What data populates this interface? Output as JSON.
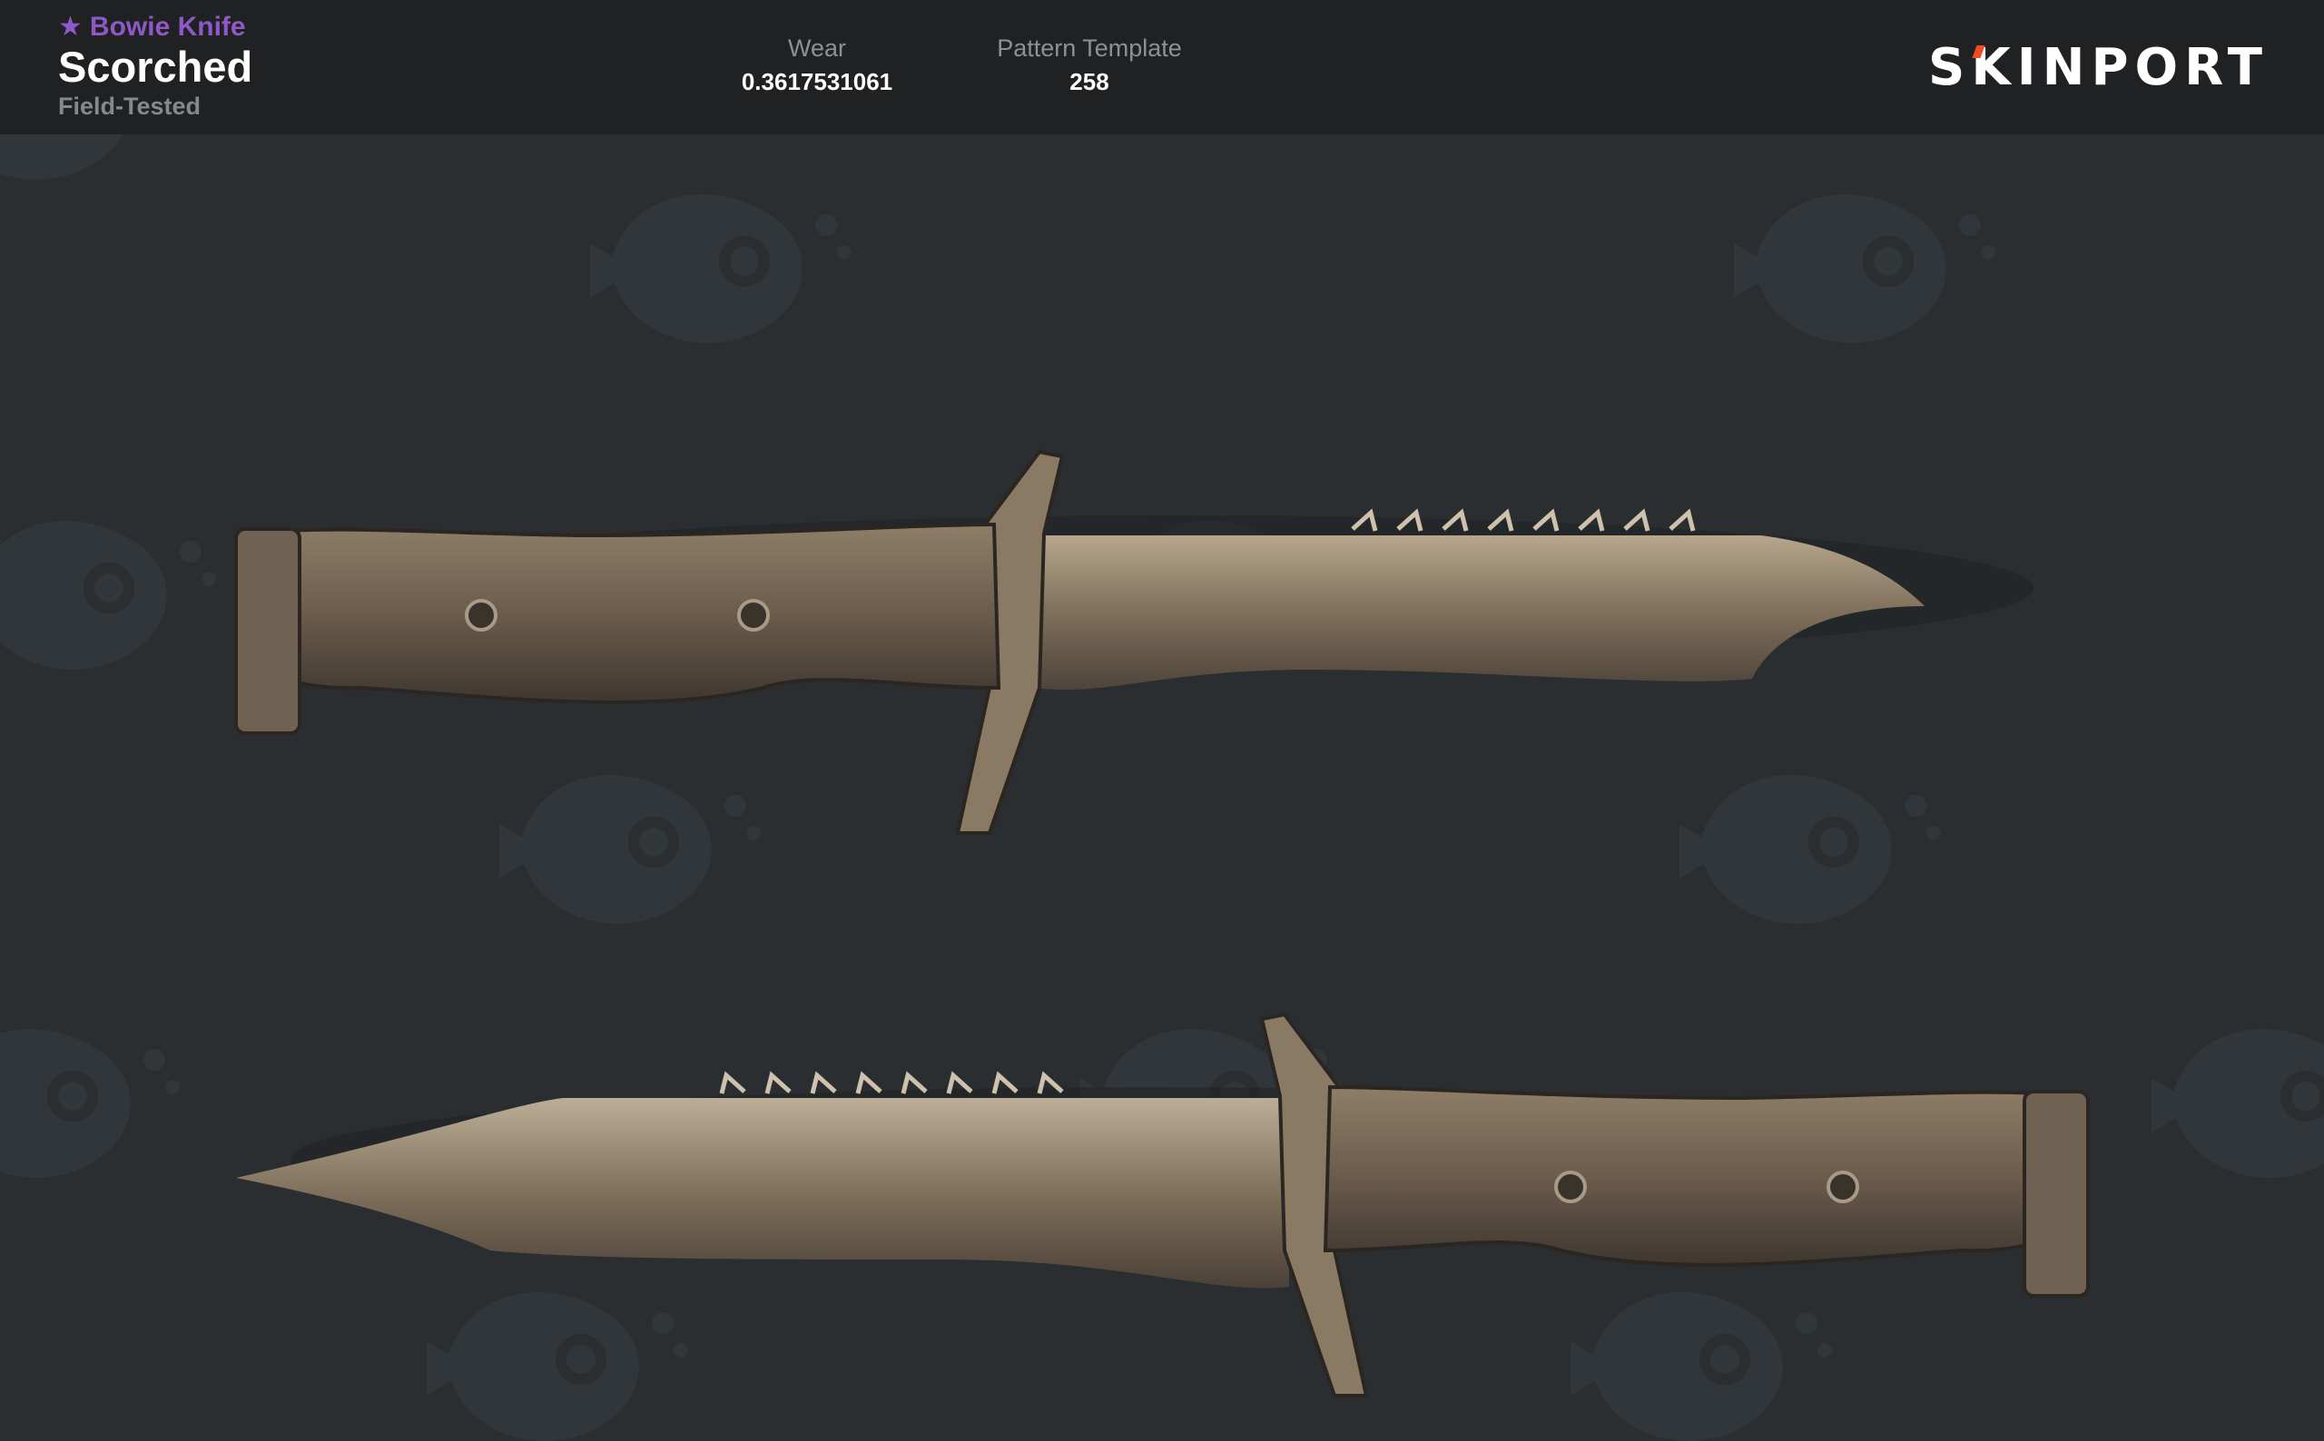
{
  "item": {
    "type_prefix": "★",
    "type": "Bowie Knife",
    "skin_name": "Scorched",
    "exterior": "Field-Tested"
  },
  "stats": {
    "wear_label": "Wear",
    "wear_value": "0.3617531061",
    "pattern_label": "Pattern Template",
    "pattern_value": "258"
  },
  "brand": {
    "logo_text_left": "S",
    "logo_text_k": "K",
    "logo_text_right": "INPORT",
    "accent_color": "#f04c23"
  },
  "colors": {
    "header_bg": "#1f2123",
    "stage_bg": "#2a2e30",
    "rarity_purple": "#8e58c7"
  }
}
